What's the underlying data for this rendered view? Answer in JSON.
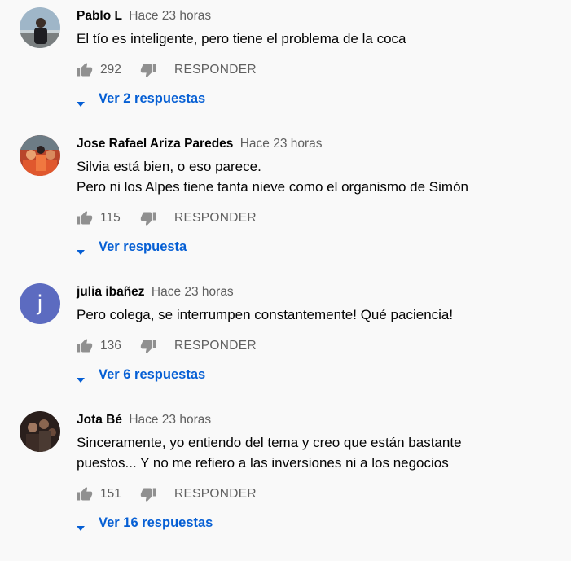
{
  "comments": [
    {
      "author": "Pablo L",
      "time": "Hace 23 horas",
      "lines": [
        "El tío es inteligente, pero tiene el problema de la coca"
      ],
      "likes": "292",
      "reply_label": "RESPONDER",
      "replies_label": "Ver 2 respuestas"
    },
    {
      "author": "Jose Rafael Ariza Paredes",
      "time": "Hace 23 horas",
      "lines": [
        "Silvia está bien, o eso parece.",
        "Pero ni los Alpes tiene tanta nieve como el organismo de Simón"
      ],
      "likes": "115",
      "reply_label": "RESPONDER",
      "replies_label": "Ver respuesta"
    },
    {
      "author": "julia ibañez",
      "time": "Hace 23 horas",
      "avatar_letter": "j",
      "lines": [
        "Pero colega, se interrumpen constantemente! Qué paciencia!"
      ],
      "likes": "136",
      "reply_label": "RESPONDER",
      "replies_label": "Ver 6 respuestas"
    },
    {
      "author": "Jota Bé",
      "time": "Hace 23 horas",
      "lines": [
        "Sinceramente, yo entiendo del tema y creo que están bastante",
        "puestos... Y no me refiero a las inversiones ni a los negocios"
      ],
      "likes": "151",
      "reply_label": "RESPONDER",
      "replies_label": "Ver 16 respuestas"
    }
  ],
  "colors": {
    "background": "#f9f9f9",
    "link_blue": "#065fd4",
    "secondary_text": "#606060",
    "letter_avatar": "#5c6bc0"
  },
  "icons": [
    "thumb-up-icon",
    "thumb-down-icon",
    "caret-down-icon"
  ]
}
